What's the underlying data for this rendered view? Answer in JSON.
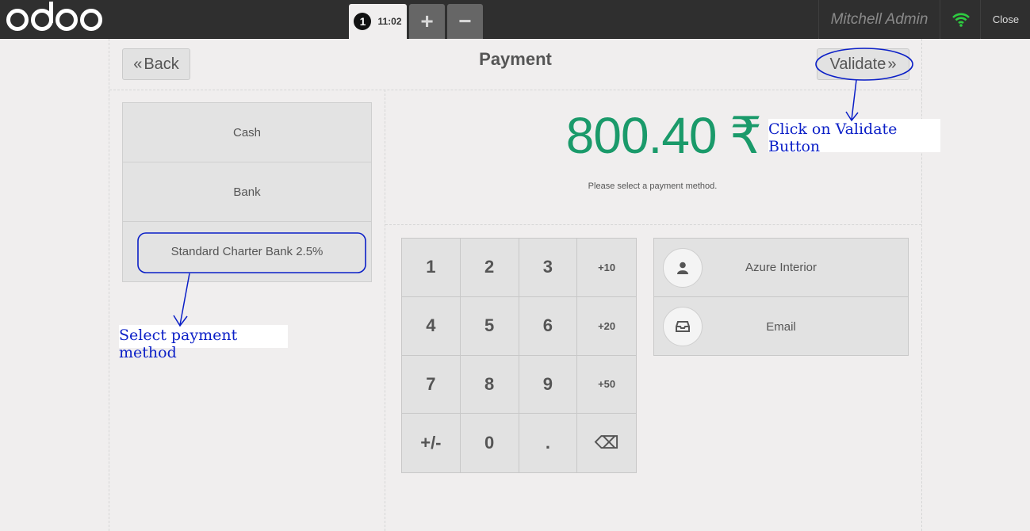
{
  "topbar": {
    "order_number": "1",
    "order_time": "11:02",
    "add_icon": "plus-icon",
    "remove_icon": "minus-icon",
    "user_name": "Mitchell Admin",
    "wifi_icon": "wifi-icon",
    "close_label": "Close"
  },
  "header": {
    "back_label": "Back",
    "title": "Payment",
    "validate_label": "Validate"
  },
  "payment_methods": [
    "Cash",
    "Bank",
    "Standard Charter Bank 2.5%"
  ],
  "summary": {
    "amount": "800.40 ₹",
    "hint": "Please select a payment method."
  },
  "numpad": {
    "keys": [
      "1",
      "2",
      "3",
      "+10",
      "4",
      "5",
      "6",
      "+20",
      "7",
      "8",
      "9",
      "+50",
      "+/-",
      "0",
      ".",
      "⌫"
    ]
  },
  "client": {
    "customer_label": "Azure Interior",
    "email_label": "Email"
  },
  "annotations": {
    "validate_note": "Click on Validate Button",
    "select_note": "Select payment method"
  },
  "colors": {
    "amount": "#1a9a6a",
    "annotation": "#0b1fc7",
    "wifi": "#2ecc40"
  }
}
